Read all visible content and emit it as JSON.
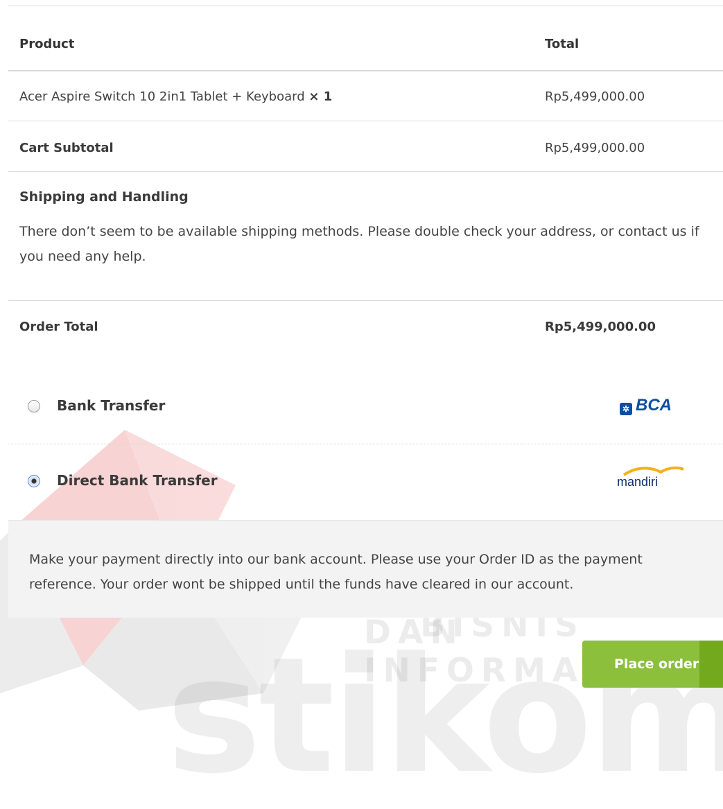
{
  "table": {
    "header_product": "Product",
    "header_total": "Total",
    "item_name": "Acer Aspire Switch 10 2in1 Tablet + Keyboard",
    "item_qty": "× 1",
    "item_total": "Rp5,499,000.00",
    "subtotal_label": "Cart Subtotal",
    "subtotal_value": "Rp5,499,000.00",
    "shipping_label": "Shipping and Handling",
    "shipping_text": "There don’t seem to be available shipping methods. Please double check your address, or contact us if you need any help.",
    "order_total_label": "Order Total",
    "order_total_value": "Rp5,499,000.00"
  },
  "payment": {
    "methods": [
      {
        "label": "Bank Transfer",
        "selected": false,
        "logo_text": "BCA"
      },
      {
        "label": "Direct Bank Transfer",
        "selected": true,
        "logo_text": "mandiri"
      }
    ],
    "description": "Make your payment directly into our bank account. Please use your Order ID as the payment reference. Your order wont be shipped until the funds have cleared in our account."
  },
  "actions": {
    "place_order_label": "Place order"
  },
  "watermark": {
    "line1": "INSTITUT BISNIS",
    "line2": "DAN INFORMATIKA",
    "brand": "stikom"
  },
  "colors": {
    "button": "#8bbf3c",
    "bca_blue": "#0c4ea2"
  }
}
